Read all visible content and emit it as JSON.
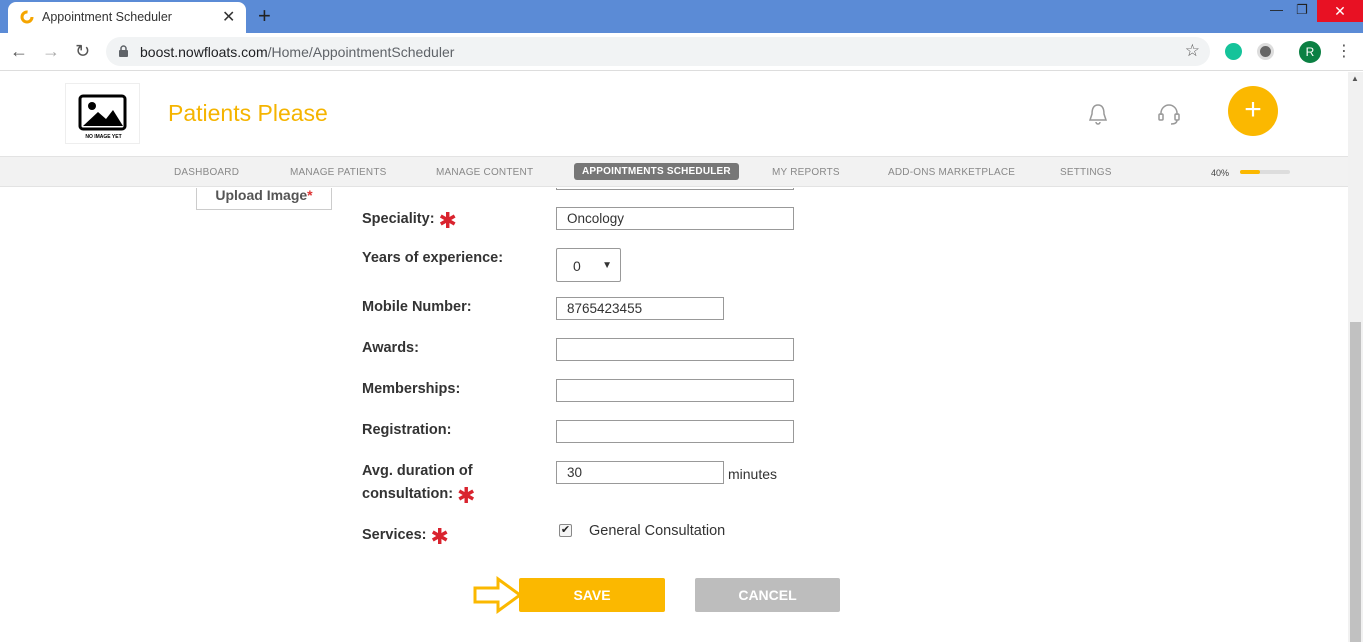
{
  "browser": {
    "tab_title": "Appointment Scheduler",
    "url_host": "boost.nowfloats.com",
    "url_path": "/Home/AppointmentScheduler",
    "profile_initial": "R"
  },
  "header": {
    "brand": "Patients Please",
    "logo_text": "NO IMAGE YET",
    "accent_color": "#fbb800"
  },
  "nav": {
    "items": [
      {
        "label": "DASHBOARD"
      },
      {
        "label": "MANAGE PATIENTS"
      },
      {
        "label": "MANAGE CONTENT"
      },
      {
        "label": "APPOINTMENTS SCHEDULER"
      },
      {
        "label": "MY REPORTS"
      },
      {
        "label": "ADD-ONS MARKETPLACE"
      },
      {
        "label": "SETTINGS"
      }
    ],
    "active_index": 3,
    "progress_label": "40%",
    "progress_value": 0.4
  },
  "form": {
    "upload_label": "Upload Image",
    "required_mark": "*",
    "speciality": {
      "label": "Speciality:",
      "value": "Oncology"
    },
    "experience": {
      "label": "Years of experience:",
      "value": "0"
    },
    "mobile": {
      "label": "Mobile Number:",
      "value": "8765423455"
    },
    "awards": {
      "label": "Awards:",
      "value": ""
    },
    "memberships": {
      "label": "Memberships:",
      "value": ""
    },
    "registration": {
      "label": "Registration:",
      "value": ""
    },
    "duration": {
      "label_line1": "Avg. duration of",
      "label_line2": "consultation:",
      "value": "30",
      "unit": "minutes"
    },
    "services": {
      "label": "Services:",
      "option": "General Consultation",
      "checked": true
    },
    "save_label": "SAVE",
    "cancel_label": "CANCEL"
  }
}
